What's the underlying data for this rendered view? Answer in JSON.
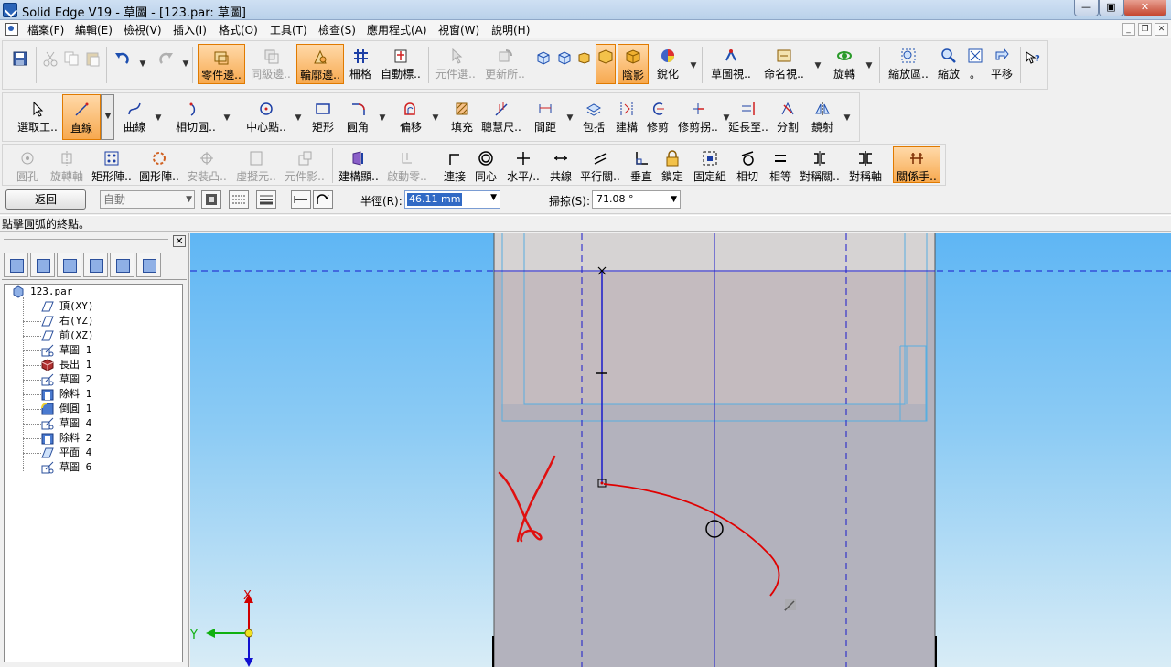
{
  "window": {
    "title": "Solid Edge V19 - 草圖 - [123.par: 草圖]",
    "min_label": "—",
    "max_label": "▣",
    "close_label": "✕"
  },
  "menu": {
    "items": [
      "檔案(F)",
      "編輯(E)",
      "檢視(V)",
      "插入(I)",
      "格式(O)",
      "工具(T)",
      "檢查(S)",
      "應用程式(A)",
      "視窗(W)",
      "說明(H)"
    ],
    "doc_controls": [
      "_",
      "❐",
      "✕"
    ]
  },
  "toolbar1": {
    "buttons": [
      {
        "label": "零件邊..",
        "icon": "part-edge-icon",
        "state": "active"
      },
      {
        "label": "同級邊..",
        "icon": "peer-edge-icon",
        "state": "disabled"
      },
      {
        "label": "輪廓邊..",
        "icon": "profile-edge-icon",
        "state": "active"
      },
      {
        "label": "柵格",
        "icon": "grid-icon",
        "state": "normal"
      },
      {
        "label": "自動標..",
        "icon": "auto-dimension-icon",
        "state": "normal"
      },
      {
        "label": "元件選..",
        "icon": "component-select-icon",
        "state": "disabled"
      },
      {
        "label": "更新所..",
        "icon": "update-all-icon",
        "state": "disabled"
      },
      {
        "label": "陰影",
        "icon": "shading-icon",
        "state": "active"
      },
      {
        "label": "銳化",
        "icon": "sharpen-icon",
        "state": "normal"
      },
      {
        "label": "草圖視..",
        "icon": "sketch-view-icon",
        "state": "normal"
      },
      {
        "label": "命名視..",
        "icon": "named-view-icon",
        "state": "normal"
      },
      {
        "label": "旋轉",
        "icon": "rotate-icon",
        "state": "normal"
      },
      {
        "label": "縮放區..",
        "icon": "zoom-area-icon",
        "state": "normal"
      },
      {
        "label": "縮放",
        "icon": "zoom-icon",
        "state": "normal"
      },
      {
        "label": "。",
        "icon": "fit-icon",
        "state": "normal"
      },
      {
        "label": "平移",
        "icon": "pan-icon",
        "state": "normal"
      }
    ]
  },
  "toolbar2": {
    "buttons": [
      {
        "label": "選取工..",
        "icon": "select-tool-icon",
        "state": "normal"
      },
      {
        "label": "直線",
        "icon": "line-icon",
        "state": "active"
      },
      {
        "label": "曲線",
        "icon": "curve-icon",
        "state": "normal"
      },
      {
        "label": "相切圓..",
        "icon": "tangent-arc-icon",
        "state": "normal"
      },
      {
        "label": "中心點..",
        "icon": "center-point-icon",
        "state": "normal"
      },
      {
        "label": "矩形",
        "icon": "rectangle-icon",
        "state": "normal"
      },
      {
        "label": "圓角",
        "icon": "fillet-icon",
        "state": "normal"
      },
      {
        "label": "偏移",
        "icon": "offset-icon",
        "state": "normal"
      },
      {
        "label": "填充",
        "icon": "fill-icon",
        "state": "normal"
      },
      {
        "label": "聰慧尺..",
        "icon": "smart-dimension-icon",
        "state": "normal"
      },
      {
        "label": "間距",
        "icon": "distance-icon",
        "state": "normal"
      },
      {
        "label": "包括",
        "icon": "include-icon",
        "state": "normal"
      },
      {
        "label": "建構",
        "icon": "construction-icon",
        "state": "normal"
      },
      {
        "label": "修剪",
        "icon": "trim-icon",
        "state": "normal"
      },
      {
        "label": "修剪拐..",
        "icon": "trim-corner-icon",
        "state": "normal"
      },
      {
        "label": "延長至..",
        "icon": "extend-icon",
        "state": "normal"
      },
      {
        "label": "分割",
        "icon": "split-icon",
        "state": "normal"
      },
      {
        "label": "鏡射",
        "icon": "mirror-icon",
        "state": "normal"
      }
    ]
  },
  "toolbar3": {
    "buttons": [
      {
        "label": "圓孔",
        "icon": "hole-icon",
        "state": "disabled"
      },
      {
        "label": "旋轉軸",
        "icon": "revolve-axis-icon",
        "state": "disabled"
      },
      {
        "label": "矩形陣..",
        "icon": "rect-pattern-icon",
        "state": "normal"
      },
      {
        "label": "圓形陣..",
        "icon": "circ-pattern-icon",
        "state": "normal"
      },
      {
        "label": "安裝凸..",
        "icon": "mounting-boss-icon",
        "state": "disabled"
      },
      {
        "label": "虛擬元..",
        "icon": "virtual-component-icon",
        "state": "disabled"
      },
      {
        "label": "元件影..",
        "icon": "component-image-icon",
        "state": "disabled"
      },
      {
        "label": "建構顯..",
        "icon": "construction-display-icon",
        "state": "normal"
      },
      {
        "label": "啟動零..",
        "icon": "activate-part-icon",
        "state": "disabled"
      },
      {
        "label": "連接",
        "icon": "connect-icon",
        "state": "normal"
      },
      {
        "label": "同心",
        "icon": "concentric-icon",
        "state": "normal"
      },
      {
        "label": "水平/..",
        "icon": "horizontal-vertical-icon",
        "state": "normal"
      },
      {
        "label": "共線",
        "icon": "collinear-icon",
        "state": "normal"
      },
      {
        "label": "平行關..",
        "icon": "parallel-icon",
        "state": "normal"
      },
      {
        "label": "垂直",
        "icon": "perpendicular-icon",
        "state": "normal"
      },
      {
        "label": "鎖定",
        "icon": "lock-icon",
        "state": "normal"
      },
      {
        "label": "固定組",
        "icon": "rigid-set-icon",
        "state": "normal"
      },
      {
        "label": "相切",
        "icon": "tangent-icon",
        "state": "normal"
      },
      {
        "label": "相等",
        "icon": "equal-icon",
        "state": "normal"
      },
      {
        "label": "對稱關..",
        "icon": "symmetric-icon",
        "state": "normal"
      },
      {
        "label": "對稱軸",
        "icon": "symmetry-axis-icon",
        "state": "normal"
      },
      {
        "label": "關係手..",
        "icon": "relationship-handles-icon",
        "state": "active"
      }
    ]
  },
  "ribbon": {
    "back_label": "返回",
    "mode_value": "自動",
    "radius_label": "半徑(R):",
    "radius_value": "46.11 mm",
    "sweep_label": "掃掠(S):",
    "sweep_value": "71.08 °"
  },
  "prompt": "點擊圓弧的終點。",
  "tree": {
    "root": "123.par",
    "items": [
      {
        "label": "頂(XY)",
        "icon": "plane-icon"
      },
      {
        "label": "右(YZ)",
        "icon": "plane-icon"
      },
      {
        "label": "前(XZ)",
        "icon": "plane-icon"
      },
      {
        "label": "草圖 1",
        "icon": "sketch-icon"
      },
      {
        "label": "長出 1",
        "icon": "protrusion-icon"
      },
      {
        "label": "草圖 2",
        "icon": "sketch-icon"
      },
      {
        "label": "除料 1",
        "icon": "cutout-icon"
      },
      {
        "label": "倒圓 1",
        "icon": "round-icon"
      },
      {
        "label": "草圖 4",
        "icon": "sketch-icon"
      },
      {
        "label": "除料 2",
        "icon": "cutout-icon"
      },
      {
        "label": "平面 4",
        "icon": "plane-icon"
      },
      {
        "label": "草圖 6",
        "icon": "sketch-icon"
      }
    ]
  },
  "triad": {
    "x_label": "X",
    "y_label": "Y"
  },
  "colors": {
    "active_button": "#f7a94f",
    "sketch_line": "#1a1acc",
    "arc_dynamic": "#e00000",
    "body_face": "#b3b2bd",
    "background_top": "#5fb6f4"
  }
}
